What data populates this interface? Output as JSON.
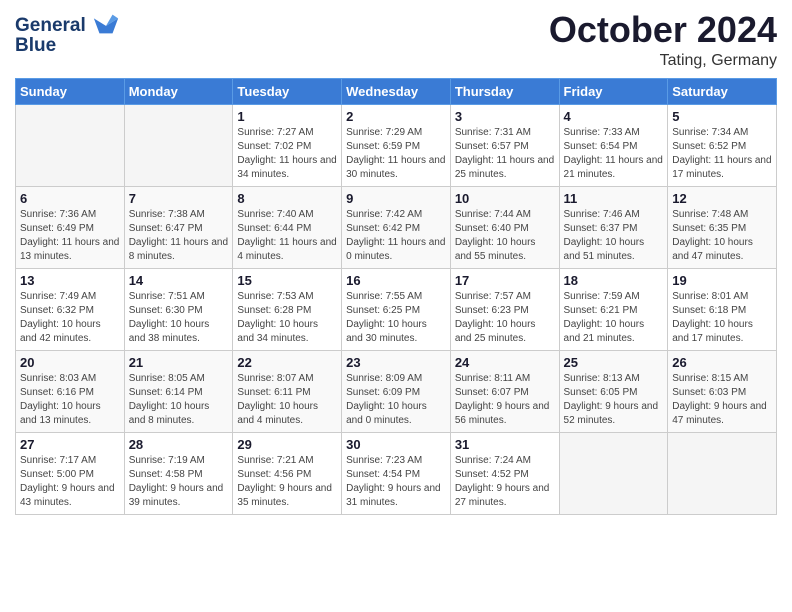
{
  "logo": {
    "line1": "General",
    "line2": "Blue"
  },
  "title": "October 2024",
  "location": "Tating, Germany",
  "weekdays": [
    "Sunday",
    "Monday",
    "Tuesday",
    "Wednesday",
    "Thursday",
    "Friday",
    "Saturday"
  ],
  "weeks": [
    [
      {
        "day": "",
        "sunrise": "",
        "sunset": "",
        "daylight": ""
      },
      {
        "day": "",
        "sunrise": "",
        "sunset": "",
        "daylight": ""
      },
      {
        "day": "1",
        "sunrise": "Sunrise: 7:27 AM",
        "sunset": "Sunset: 7:02 PM",
        "daylight": "Daylight: 11 hours and 34 minutes."
      },
      {
        "day": "2",
        "sunrise": "Sunrise: 7:29 AM",
        "sunset": "Sunset: 6:59 PM",
        "daylight": "Daylight: 11 hours and 30 minutes."
      },
      {
        "day": "3",
        "sunrise": "Sunrise: 7:31 AM",
        "sunset": "Sunset: 6:57 PM",
        "daylight": "Daylight: 11 hours and 25 minutes."
      },
      {
        "day": "4",
        "sunrise": "Sunrise: 7:33 AM",
        "sunset": "Sunset: 6:54 PM",
        "daylight": "Daylight: 11 hours and 21 minutes."
      },
      {
        "day": "5",
        "sunrise": "Sunrise: 7:34 AM",
        "sunset": "Sunset: 6:52 PM",
        "daylight": "Daylight: 11 hours and 17 minutes."
      }
    ],
    [
      {
        "day": "6",
        "sunrise": "Sunrise: 7:36 AM",
        "sunset": "Sunset: 6:49 PM",
        "daylight": "Daylight: 11 hours and 13 minutes."
      },
      {
        "day": "7",
        "sunrise": "Sunrise: 7:38 AM",
        "sunset": "Sunset: 6:47 PM",
        "daylight": "Daylight: 11 hours and 8 minutes."
      },
      {
        "day": "8",
        "sunrise": "Sunrise: 7:40 AM",
        "sunset": "Sunset: 6:44 PM",
        "daylight": "Daylight: 11 hours and 4 minutes."
      },
      {
        "day": "9",
        "sunrise": "Sunrise: 7:42 AM",
        "sunset": "Sunset: 6:42 PM",
        "daylight": "Daylight: 11 hours and 0 minutes."
      },
      {
        "day": "10",
        "sunrise": "Sunrise: 7:44 AM",
        "sunset": "Sunset: 6:40 PM",
        "daylight": "Daylight: 10 hours and 55 minutes."
      },
      {
        "day": "11",
        "sunrise": "Sunrise: 7:46 AM",
        "sunset": "Sunset: 6:37 PM",
        "daylight": "Daylight: 10 hours and 51 minutes."
      },
      {
        "day": "12",
        "sunrise": "Sunrise: 7:48 AM",
        "sunset": "Sunset: 6:35 PM",
        "daylight": "Daylight: 10 hours and 47 minutes."
      }
    ],
    [
      {
        "day": "13",
        "sunrise": "Sunrise: 7:49 AM",
        "sunset": "Sunset: 6:32 PM",
        "daylight": "Daylight: 10 hours and 42 minutes."
      },
      {
        "day": "14",
        "sunrise": "Sunrise: 7:51 AM",
        "sunset": "Sunset: 6:30 PM",
        "daylight": "Daylight: 10 hours and 38 minutes."
      },
      {
        "day": "15",
        "sunrise": "Sunrise: 7:53 AM",
        "sunset": "Sunset: 6:28 PM",
        "daylight": "Daylight: 10 hours and 34 minutes."
      },
      {
        "day": "16",
        "sunrise": "Sunrise: 7:55 AM",
        "sunset": "Sunset: 6:25 PM",
        "daylight": "Daylight: 10 hours and 30 minutes."
      },
      {
        "day": "17",
        "sunrise": "Sunrise: 7:57 AM",
        "sunset": "Sunset: 6:23 PM",
        "daylight": "Daylight: 10 hours and 25 minutes."
      },
      {
        "day": "18",
        "sunrise": "Sunrise: 7:59 AM",
        "sunset": "Sunset: 6:21 PM",
        "daylight": "Daylight: 10 hours and 21 minutes."
      },
      {
        "day": "19",
        "sunrise": "Sunrise: 8:01 AM",
        "sunset": "Sunset: 6:18 PM",
        "daylight": "Daylight: 10 hours and 17 minutes."
      }
    ],
    [
      {
        "day": "20",
        "sunrise": "Sunrise: 8:03 AM",
        "sunset": "Sunset: 6:16 PM",
        "daylight": "Daylight: 10 hours and 13 minutes."
      },
      {
        "day": "21",
        "sunrise": "Sunrise: 8:05 AM",
        "sunset": "Sunset: 6:14 PM",
        "daylight": "Daylight: 10 hours and 8 minutes."
      },
      {
        "day": "22",
        "sunrise": "Sunrise: 8:07 AM",
        "sunset": "Sunset: 6:11 PM",
        "daylight": "Daylight: 10 hours and 4 minutes."
      },
      {
        "day": "23",
        "sunrise": "Sunrise: 8:09 AM",
        "sunset": "Sunset: 6:09 PM",
        "daylight": "Daylight: 10 hours and 0 minutes."
      },
      {
        "day": "24",
        "sunrise": "Sunrise: 8:11 AM",
        "sunset": "Sunset: 6:07 PM",
        "daylight": "Daylight: 9 hours and 56 minutes."
      },
      {
        "day": "25",
        "sunrise": "Sunrise: 8:13 AM",
        "sunset": "Sunset: 6:05 PM",
        "daylight": "Daylight: 9 hours and 52 minutes."
      },
      {
        "day": "26",
        "sunrise": "Sunrise: 8:15 AM",
        "sunset": "Sunset: 6:03 PM",
        "daylight": "Daylight: 9 hours and 47 minutes."
      }
    ],
    [
      {
        "day": "27",
        "sunrise": "Sunrise: 7:17 AM",
        "sunset": "Sunset: 5:00 PM",
        "daylight": "Daylight: 9 hours and 43 minutes."
      },
      {
        "day": "28",
        "sunrise": "Sunrise: 7:19 AM",
        "sunset": "Sunset: 4:58 PM",
        "daylight": "Daylight: 9 hours and 39 minutes."
      },
      {
        "day": "29",
        "sunrise": "Sunrise: 7:21 AM",
        "sunset": "Sunset: 4:56 PM",
        "daylight": "Daylight: 9 hours and 35 minutes."
      },
      {
        "day": "30",
        "sunrise": "Sunrise: 7:23 AM",
        "sunset": "Sunset: 4:54 PM",
        "daylight": "Daylight: 9 hours and 31 minutes."
      },
      {
        "day": "31",
        "sunrise": "Sunrise: 7:24 AM",
        "sunset": "Sunset: 4:52 PM",
        "daylight": "Daylight: 9 hours and 27 minutes."
      },
      {
        "day": "",
        "sunrise": "",
        "sunset": "",
        "daylight": ""
      },
      {
        "day": "",
        "sunrise": "",
        "sunset": "",
        "daylight": ""
      }
    ]
  ]
}
